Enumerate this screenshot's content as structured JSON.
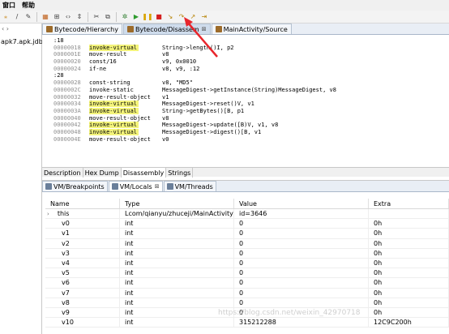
{
  "menubar": {
    "items": [
      "窗口",
      "帮助"
    ]
  },
  "toolbar": {
    "icons": [
      "pin-icon",
      "edit-icon",
      "grid-icon",
      "hierarchy-icon",
      "code-tags-icon",
      "nav-icon",
      "cut-icon",
      "copy-icon",
      "debug-icon",
      "run-icon",
      "pause-icon",
      "stop-icon",
      "step-into-icon",
      "step-over-icon",
      "step-return-icon",
      "run-to-line-icon"
    ]
  },
  "left_panel": {
    "item": "apk7.apk.jdb"
  },
  "editor_tabs": [
    {
      "label": "Bytecode/Hierarchy",
      "active": false,
      "closable": false
    },
    {
      "label": "Bytecode/Disassem",
      "active": true,
      "closable": true
    },
    {
      "label": "MainActivity/Source",
      "active": false,
      "closable": false
    }
  ],
  "code": [
    {
      "addr": ":18",
      "op": "",
      "arg": ""
    },
    {
      "addr": "00000018",
      "op": "invoke-virtual",
      "hl": true,
      "arg": "String->length()I, p2"
    },
    {
      "addr": "0000001E",
      "op": "move-result",
      "arg": "v8"
    },
    {
      "addr": "00000020",
      "op": "const/16",
      "arg": "v9, 0x0010"
    },
    {
      "addr": "00000024",
      "op": "if-ne",
      "arg": "v8, v9, :12"
    },
    {
      "addr": ":28",
      "op": "",
      "arg": ""
    },
    {
      "addr": "00000028",
      "op": "const-string",
      "arg": "v8, \"MD5\""
    },
    {
      "addr": "0000002C",
      "op": "invoke-static",
      "arg": "MessageDigest->getInstance(String)MessageDigest, v8"
    },
    {
      "addr": "00000032",
      "op": "move-result-object",
      "arg": "v1"
    },
    {
      "addr": "00000034",
      "op": "invoke-virtual",
      "hl": true,
      "arg": "MessageDigest->reset()V, v1"
    },
    {
      "addr": "0000003A",
      "op": "invoke-virtual",
      "hl": true,
      "arg": "String->getBytes()[B, p1"
    },
    {
      "addr": "00000040",
      "op": "move-result-object",
      "arg": "v8"
    },
    {
      "addr": "00000042",
      "op": "invoke-virtual",
      "hl": true,
      "arg": "MessageDigest->update([B)V, v1, v8"
    },
    {
      "addr": "00000048",
      "op": "invoke-virtual",
      "hl": true,
      "arg": "MessageDigest->digest()[B, v1"
    },
    {
      "addr": "0000004E",
      "op": "move-result-object",
      "arg": "v0"
    }
  ],
  "editor_bottom_tabs": [
    {
      "label": "Description",
      "active": false
    },
    {
      "label": "Hex Dump",
      "active": false
    },
    {
      "label": "Disassembly",
      "active": true
    },
    {
      "label": "Strings",
      "active": false
    }
  ],
  "vm_tabs": [
    {
      "label": "VM/Breakpoints",
      "active": false,
      "closable": false
    },
    {
      "label": "VM/Locals",
      "active": true,
      "closable": true
    },
    {
      "label": "VM/Threads",
      "active": false,
      "closable": false
    }
  ],
  "locals": {
    "headers": [
      "Name",
      "Type",
      "Value",
      "Extra"
    ],
    "rows": [
      {
        "name": "this",
        "expandable": true,
        "type": "Lcom/qianyu/zhuceji/MainActivity;",
        "value": "id=3646",
        "extra": ""
      },
      {
        "name": "v0",
        "type": "int",
        "value": "0",
        "extra": "0h"
      },
      {
        "name": "v1",
        "type": "int",
        "value": "0",
        "extra": "0h"
      },
      {
        "name": "v2",
        "type": "int",
        "value": "0",
        "extra": "0h"
      },
      {
        "name": "v3",
        "type": "int",
        "value": "0",
        "extra": "0h"
      },
      {
        "name": "v4",
        "type": "int",
        "value": "0",
        "extra": "0h"
      },
      {
        "name": "v5",
        "type": "int",
        "value": "0",
        "extra": "0h"
      },
      {
        "name": "v6",
        "type": "int",
        "value": "0",
        "extra": "0h"
      },
      {
        "name": "v7",
        "type": "int",
        "value": "0",
        "extra": "0h"
      },
      {
        "name": "v8",
        "type": "int",
        "value": "0",
        "extra": "0h"
      },
      {
        "name": "v9",
        "type": "int",
        "value": "0",
        "extra": "0h"
      },
      {
        "name": "v10",
        "type": "int",
        "value": "315212288",
        "extra": "12C9C200h"
      }
    ]
  },
  "watermark": "https://blog.csdn.net/weixin_42970718",
  "colors": {
    "highlight": "#f3f37a",
    "annotation_arrow": "#e8252b",
    "method_ref": "#7e5ab8"
  }
}
